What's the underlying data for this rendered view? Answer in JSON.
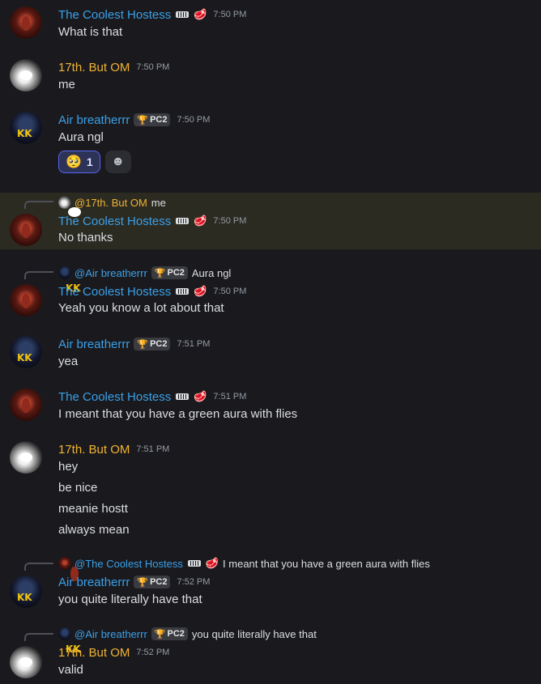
{
  "users": {
    "host": {
      "name": "The Coolest Hostess"
    },
    "om": {
      "name": "17th. But OM"
    },
    "air": {
      "name": "Air breatherrr",
      "badge": "PC2"
    }
  },
  "messages": [
    {
      "author": "The Coolest Hostess",
      "time": "7:50 PM",
      "lines": [
        "What is that"
      ]
    },
    {
      "author": "17th. But OM",
      "time": "7:50 PM",
      "lines": [
        "me"
      ]
    },
    {
      "author": "Air breatherrr",
      "badge": "PC2",
      "time": "7:50 PM",
      "lines": [
        "Aura ngl"
      ],
      "reactions": [
        {
          "emoji": "🥺",
          "count": "1"
        }
      ]
    },
    {
      "reply_to": "@17th. But OM",
      "reply_text": "me",
      "author": "The Coolest Hostess",
      "time": "7:50 PM",
      "lines": [
        "No thanks"
      ],
      "highlight": true
    },
    {
      "reply_to": "@Air breatherrr",
      "reply_badge": "PC2",
      "reply_text": "Aura ngl",
      "author": "The Coolest Hostess",
      "time": "7:50 PM",
      "lines": [
        "Yeah you know a lot about that"
      ]
    },
    {
      "author": "Air breatherrr",
      "badge": "PC2",
      "time": "7:51 PM",
      "lines": [
        "yea"
      ]
    },
    {
      "author": "The Coolest Hostess",
      "time": "7:51 PM",
      "lines": [
        "I meant that you have a green aura with flies"
      ]
    },
    {
      "author": "17th. But OM",
      "time": "7:51 PM",
      "lines": [
        "hey",
        "be nice",
        "meanie hostt",
        "always mean"
      ]
    },
    {
      "reply_to": "@The Coolest Hostess",
      "reply_text": "I meant that you have a green aura with flies",
      "author": "Air breatherrr",
      "badge": "PC2",
      "time": "7:52 PM",
      "lines": [
        "you quite literally have that"
      ]
    },
    {
      "reply_to": "@Air breatherrr",
      "reply_badge": "PC2",
      "reply_text": "you quite literally have that",
      "author": "17th. But OM",
      "time": "7:52 PM",
      "lines": [
        "valid"
      ]
    }
  ],
  "colors": {
    "background": "#1a1a1e",
    "highlight": "#2c2b22",
    "host_name": "#3aa0e8",
    "om_name": "#f0b232",
    "air_name": "#3aa0e8",
    "reaction_border": "#5865f2"
  }
}
